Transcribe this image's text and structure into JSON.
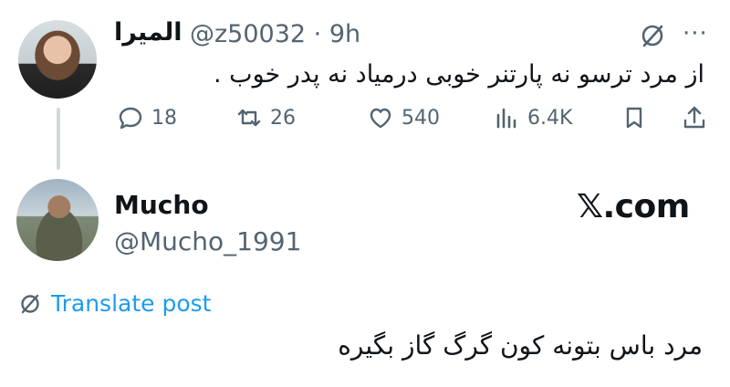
{
  "reply_to": {
    "display_name": "الميرا",
    "handle": "@z50032",
    "separator": "·",
    "time": "9h",
    "text": "از مرد ترسو نه پارتنر خوبی درمیاد نه پدر خوب .",
    "more_label": "···",
    "stats": {
      "replies": "18",
      "reposts": "26",
      "likes": "540",
      "views": "6.4K"
    }
  },
  "tweet": {
    "display_name": "Mucho",
    "handle": "@Mucho_1991",
    "site_label": "𝕏.com",
    "translate_label": "Translate post",
    "text": "مرد باس بتونه کون گرگ گاز بگیره"
  },
  "colors": {
    "text": "#0f1419",
    "secondary": "#536471",
    "link": "#1d9bf0",
    "thread_line": "#cfd9de"
  },
  "icons": [
    "reply-icon",
    "repost-icon",
    "like-icon",
    "views-icon",
    "bookmark-icon",
    "share-icon",
    "grok-icon",
    "translate-icon"
  ]
}
